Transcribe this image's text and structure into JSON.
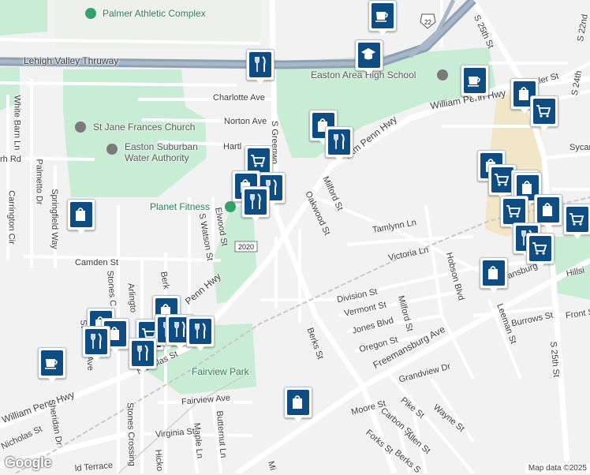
{
  "map": {
    "colors": {
      "park": "#c9ecd4",
      "road": "#ffffff",
      "highway": "#8fa1b5",
      "pin": "#0f4c81",
      "poi_green": "#34a26b",
      "school_area": "#f1e6c8"
    },
    "attribution": "Map data ©2025",
    "logo": "Google",
    "places": {
      "palmer": "Palmer Athletic Complex",
      "high_school": "Easton Area High School",
      "st_jane": "St Jane Frances Church",
      "water_1": "Easton Suburban",
      "water_2": "Water Authority",
      "planet_fitness": "Planet Fitness",
      "fairview_park": "Fairview Park"
    },
    "route_badges": {
      "us22": "22",
      "pa2020": "2020"
    },
    "streets": {
      "lehigh_valley": "Lehigh Valley Thruway",
      "charlotte": "Charlotte Ave",
      "norton": "Norton Ave",
      "hartley": "Hartl",
      "white_barn": "White Barn Ln",
      "rh": "rh Rd",
      "palmetto": "Palmetto Dr",
      "carrington": "Carrington Cir",
      "springfield": "Springfield Way",
      "s_greenwood": "S Greenwo",
      "s_25th_top": "S 25th St",
      "s_22nd": "S 22nd",
      "s_24th": "S 24th",
      "butler": "tler St",
      "william_penn_ne": "William Penn Hwy",
      "william_penn_mid": "liam Penn Hwy",
      "william_penn_sw": "William Penn Hwy",
      "penn_hwy": "Penn Hwy",
      "milford_top": "Milford St",
      "oakwood": "Oakwood St",
      "tamlynn": "Tamlynn Ln",
      "victoria": "Victoria Ln",
      "hobson": "Hobson Blvd",
      "sycam": "Sycam",
      "hillsi": "Hillsi",
      "camden": "Camden St",
      "s_watson": "S Watson St",
      "elwood": "Elwood St",
      "berk_top": "Berk",
      "stones_c": "Stones C",
      "arlington": "Arlingto",
      "division": "Division St",
      "vermont": "Vermont St",
      "jones": "Jones Blvd",
      "milford_mid": "Milford St",
      "oregon": "Oregon St",
      "freemansburg_ne": "Freemansburg",
      "freemansburg_main": "Freemansburg Ave",
      "leeman": "Leeman St",
      "burrows": "Burrows St",
      "front": "Front S",
      "s_25th_bottom": "S 25th St",
      "berks": "Berks St",
      "nicholas_mid": "Nicholas St",
      "nicholas_sw": "Nicholas St",
      "sheridan": "Sheridan Dr",
      "stones_crossing": "Stones Crossing",
      "fairview_ave": "Fairview Ave",
      "butternut": "Butternut Ln",
      "maple": "Maple Ln",
      "virginia": "Virginia St",
      "hicko": "Hicko",
      "terrace": "ld Terrace",
      "grandview": "Grandview Dr",
      "moore": "Moore St",
      "carbon": "Carbon St",
      "pike": "Pike St",
      "wayne": "Wayne St",
      "forks": "Forks St",
      "allen": "Allen St",
      "berks_s": "Berks S",
      "ave_frag": "Ave",
      "st_frag": "St",
      "mi_frag": "Mi"
    },
    "markers": [
      {
        "type": "shopping",
        "icon": "shopping-bag-icon"
      },
      {
        "type": "restaurant",
        "icon": "fork-knife-icon"
      },
      {
        "type": "school",
        "icon": "graduation-cap-icon"
      },
      {
        "type": "cafe",
        "icon": "coffee-cup-icon"
      },
      {
        "type": "grocery",
        "icon": "shopping-cart-icon"
      }
    ]
  }
}
